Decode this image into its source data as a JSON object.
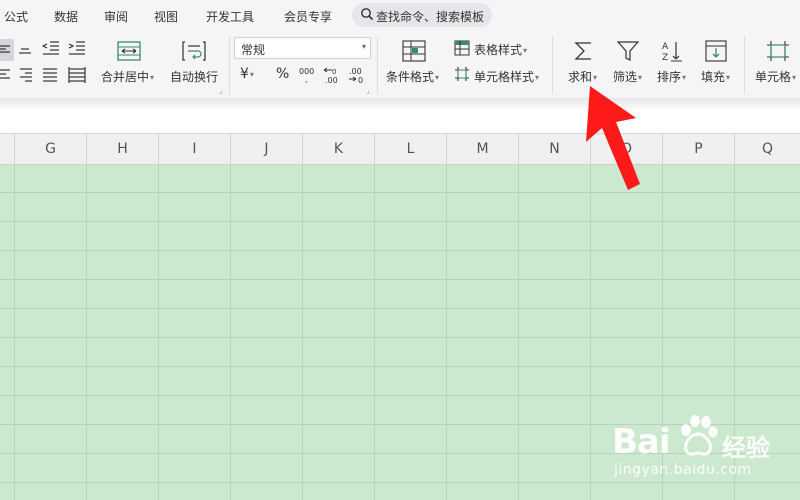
{
  "menu": {
    "items": [
      "公式",
      "数据",
      "审阅",
      "视图",
      "开发工具",
      "会员专享"
    ],
    "search_placeholder": "查找命令、搜索模板"
  },
  "ribbon": {
    "merge_center": "合并居中",
    "wrap_text": "自动换行",
    "number_format": "常规",
    "currency_symbol": "¥",
    "percent_symbol": "%",
    "conditional_format": "条件格式",
    "table_style": "表格样式",
    "cell_style": "单元格样式",
    "sum": "求和",
    "filter": "筛选",
    "sort": "排序",
    "fill": "填充",
    "cell": "单元格"
  },
  "columns": [
    "G",
    "H",
    "I",
    "J",
    "K",
    "L",
    "M",
    "N",
    "O",
    "P",
    "Q"
  ],
  "watermark": {
    "brand": "Bai",
    "brand_cn": "经验",
    "url": "jingyan.baidu.com"
  },
  "colors": {
    "sheet_bg": "#cce8cf",
    "arrow": "#ff1a1a"
  }
}
